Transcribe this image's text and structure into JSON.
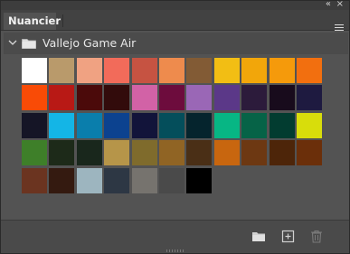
{
  "panel": {
    "tab_label": "Nuancier",
    "collapse_glyph": "«",
    "close_glyph": "×",
    "group_name": "Vallejo Game Air"
  },
  "icons": {
    "collapse": "double-chevron-left-icon",
    "close": "close-icon",
    "menu": "hamburger-menu-icon",
    "chevron": "chevron-down-icon",
    "folder": "folder-icon",
    "new_group": "new-folder-icon",
    "new_swatch": "add-swatch-icon",
    "delete": "trash-icon"
  },
  "swatches": [
    [
      "#ffffff",
      "#b99a6b",
      "#f0a282",
      "#f26b5a",
      "#c65342",
      "#ee8b4d",
      "#825b35",
      "#f2be14",
      "#f2a60a",
      "#f59a0b",
      "#f26f0f"
    ],
    [
      "#f94b06",
      "#b81915",
      "#4b0a0a",
      "#320b0b",
      "#d262a6",
      "#6d0c3d",
      "#9a67b6",
      "#5b3888",
      "#2c1b3b",
      "#180b1c",
      "#1e1a40"
    ],
    [
      "#151526",
      "#14b5e6",
      "#0a7eac",
      "#0c428f",
      "#12143a",
      "#044e5b",
      "#05242d",
      "#07b684",
      "#066347",
      "#023c30",
      "#d8dd0b"
    ],
    [
      "#3e7f29",
      "#1d2a19",
      "#19271c",
      "#b69549",
      "#7f6b2c",
      "#906424",
      "#4a2f16",
      "#c8660f",
      "#6d3812",
      "#4d2509",
      "#6b2f0a"
    ],
    [
      "#6b3420",
      "#341a10",
      "#9db5bf",
      "#2d3744",
      "#76736e",
      "#4a4a4a",
      "#000000"
    ]
  ]
}
